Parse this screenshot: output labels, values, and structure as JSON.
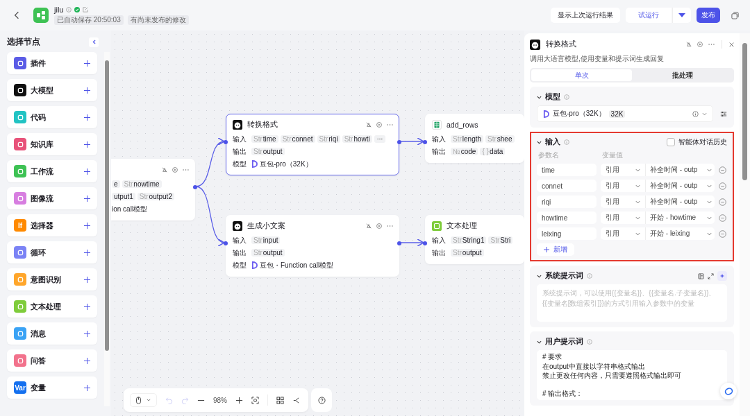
{
  "header": {
    "title": "jilu",
    "autosave": "已自动保存 20:50:03",
    "unpublished": "有尚未发布的修改",
    "last_result": "显示上次运行结果",
    "test_run": "试运行",
    "publish": "发布"
  },
  "sidebar": {
    "title": "选择节点",
    "items": [
      {
        "label": "插件",
        "color": "#5b5ce6"
      },
      {
        "label": "大模型",
        "color": "#111111"
      },
      {
        "label": "代码",
        "color": "#22c3c3"
      },
      {
        "label": "知识库",
        "color": "#e8527a"
      },
      {
        "label": "工作流",
        "color": "#3ec254"
      },
      {
        "label": "图像流",
        "color": "#d77ee0"
      },
      {
        "label": "选择器",
        "color": "#ff8a00",
        "icon_text": "If"
      },
      {
        "label": "循环",
        "color": "#7b83f5"
      },
      {
        "label": "意图识别",
        "color": "#ffa62b"
      },
      {
        "label": "文本处理",
        "color": "#7fcc3b"
      },
      {
        "label": "消息",
        "color": "#3aa3f5"
      },
      {
        "label": "问答",
        "color": "#f2728c"
      },
      {
        "label": "变量",
        "color": "#1570ef",
        "icon_text": "Var"
      }
    ]
  },
  "canvas": {
    "nodes": [
      {
        "kind": "partial",
        "selected": false,
        "rows": [
          {
            "kind": "params",
            "params": [
              {
                "kind": "tag",
                "name": "e"
              },
              {
                "kind": "tag",
                "type": "Str",
                "name": "nowtime"
              }
            ]
          },
          {
            "kind": "params",
            "params": [
              {
                "kind": "tag",
                "name": "utput1"
              },
              {
                "kind": "tag",
                "type": "Str",
                "name": "output2"
              }
            ]
          },
          {
            "kind": "model",
            "model": "ion call模型"
          }
        ]
      },
      {
        "kind": "llm",
        "title": "转换格式",
        "selected": true,
        "rows": [
          {
            "kind": "params",
            "label": "输入",
            "params": [
              {
                "kind": "tag",
                "type": "Str",
                "name": "time"
              },
              {
                "kind": "tag",
                "type": "Str",
                "name": "connet"
              },
              {
                "kind": "tag",
                "type": "Str",
                "name": "riqi"
              },
              {
                "kind": "tag",
                "type": "Str",
                "name": "howti"
              },
              {
                "kind": "more"
              }
            ]
          },
          {
            "kind": "params",
            "label": "输出",
            "params": [
              {
                "kind": "tag",
                "type": "Str",
                "name": "output"
              }
            ]
          },
          {
            "kind": "model",
            "label": "模型",
            "model": "豆包-pro（32K）"
          }
        ]
      },
      {
        "kind": "llm",
        "title": "生成小文案",
        "selected": false,
        "rows": [
          {
            "kind": "params",
            "label": "输入",
            "params": [
              {
                "kind": "tag",
                "type": "Str",
                "name": "input"
              }
            ]
          },
          {
            "kind": "params",
            "label": "输出",
            "params": [
              {
                "kind": "tag",
                "type": "Str",
                "name": "output"
              }
            ]
          },
          {
            "kind": "model",
            "label": "模型",
            "model": "豆包・Function call模型"
          }
        ]
      },
      {
        "kind": "sheet",
        "title": "add_rows",
        "selected": false,
        "rows": [
          {
            "kind": "params",
            "label": "输入",
            "params": [
              {
                "kind": "tag",
                "type": "Str",
                "name": "length"
              },
              {
                "kind": "tag",
                "type": "Str",
                "name": "shee"
              }
            ]
          },
          {
            "kind": "params",
            "label": "输出",
            "params": [
              {
                "kind": "tag",
                "type": "№",
                "name": "code"
              },
              {
                "kind": "tag",
                "type": "{ }",
                "name": "data"
              }
            ]
          }
        ]
      },
      {
        "kind": "text",
        "title": "文本处理",
        "selected": false,
        "rows": [
          {
            "kind": "params",
            "label": "输入",
            "params": [
              {
                "kind": "tag",
                "type": "Str",
                "name": "String1"
              },
              {
                "kind": "tag",
                "type": "Str",
                "name": "Stri"
              }
            ]
          },
          {
            "kind": "params",
            "label": "输出",
            "params": [
              {
                "kind": "tag",
                "type": "Str",
                "name": "output"
              }
            ]
          }
        ]
      }
    ],
    "zoom": "98%"
  },
  "panel": {
    "title": "转换格式",
    "description": "调用大语言模型,使用变量和提示词生成回复",
    "tabs": [
      {
        "label": "单次",
        "selected": true
      },
      {
        "label": "批处理",
        "selected": false
      }
    ],
    "model_section": {
      "title": "模型",
      "model": "豆包-pro（32K）",
      "badge": "32K"
    },
    "input_section": {
      "title": "输入",
      "highlighted": true,
      "history": {
        "label": "智能体对话历史",
        "checked": false
      },
      "columns": [
        "参数名",
        "变量值"
      ],
      "rows": [
        {
          "name": "time",
          "mode": "引用",
          "value": "补全时间 - outp"
        },
        {
          "name": "connet",
          "mode": "引用",
          "value": "补全时间 - outp"
        },
        {
          "name": "riqi",
          "mode": "引用",
          "value": "补全时间 - outp"
        },
        {
          "name": "howtime",
          "mode": "引用",
          "value": "开始 - howtime"
        },
        {
          "name": "leixing",
          "mode": "引用",
          "value": "开始 - leixing"
        }
      ],
      "add": "新增"
    },
    "system_prompt": {
      "title": "系统提示词",
      "placeholder": "系统提示词，可以使用{{变量名}}、{{变量名.子变量名}}、{{变量名[数组索引]}}的方式引用输入参数中的变量"
    },
    "user_prompt": {
      "title": "用户提示词",
      "lines": [
        {
          "text": "# 要求",
          "gap_before": false
        },
        {
          "text": "在output中直接以字符串格式输出",
          "gap_before": false
        },
        {
          "text": "禁止更改任何内容，只需要遵照格式输出即可",
          "gap_before": false
        },
        {
          "text": "# 输出格式：",
          "gap_before": true
        }
      ]
    }
  }
}
